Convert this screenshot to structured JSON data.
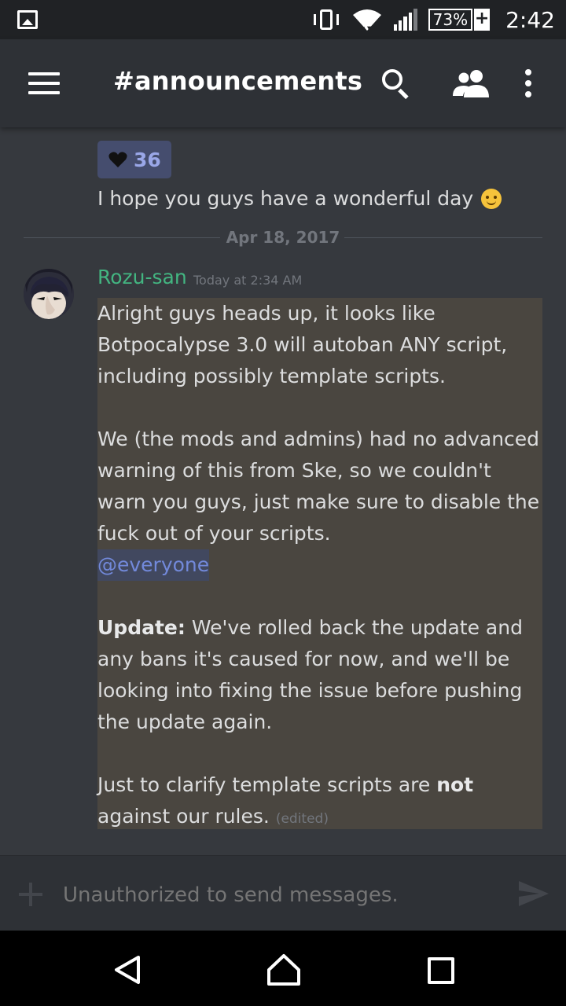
{
  "status_bar": {
    "battery": "73%",
    "time": "2:42",
    "icons": [
      "gallery-icon",
      "vibrate-icon",
      "wifi-icon",
      "signal-icon",
      "battery-icon"
    ]
  },
  "app_bar": {
    "menu_icon": "hamburger-menu-icon",
    "channel_title": "#announcements",
    "actions": [
      "search-icon",
      "members-icon",
      "more-vert-icon"
    ]
  },
  "messages": {
    "previous": {
      "reaction": {
        "icon": "heart-icon",
        "count": "36"
      },
      "line": "I hope you guys have a wonderful day",
      "emoji": "smile-emoji-icon"
    },
    "date_divider": "Apr 18, 2017",
    "post": {
      "author": "Rozu-san",
      "author_color": "#43b581",
      "timestamp": "Today at 2:34 AM",
      "para1": "Alright guys heads up, it looks like Botpocalypse 3.0 will autoban ANY script, including possibly template scripts.",
      "para2": "We (the mods and admins) had no advanced warning of this from Ske, so we couldn't warn you guys, just make sure to disable the fuck out of your scripts.",
      "mention": "@everyone",
      "update_label": "Update:",
      "update_text": " We've rolled back the update and any bans it's caused for now, and we'll be looking into fixing the issue before pushing the update again.",
      "clarify_pre": "Just to clarify template scripts are ",
      "clarify_bold": "not",
      "clarify_post": " against our rules.",
      "edited": "(edited)"
    }
  },
  "composer": {
    "placeholder": "Unauthorized to send messages.",
    "left_icon": "plus-icon",
    "right_icon": "send-icon"
  },
  "nav_bar": [
    "back-icon",
    "home-icon",
    "recents-icon"
  ],
  "colors": {
    "background": "#36393e",
    "app_bar": "#2e3136",
    "accent": "#7289da",
    "mention_highlight": "#4a4640"
  }
}
